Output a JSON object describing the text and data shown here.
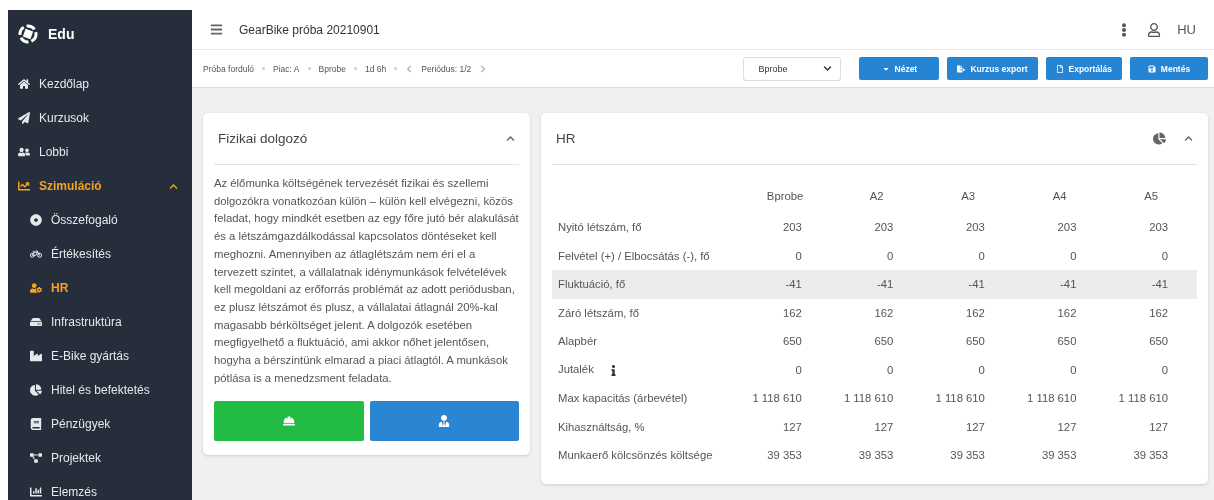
{
  "sidebar": {
    "brand": "Edu",
    "items": [
      {
        "label": "Kezdőlap",
        "selected": false
      },
      {
        "label": "Kurzusok",
        "selected": false
      },
      {
        "label": "Lobbi",
        "selected": false
      },
      {
        "label": "Szimuláció",
        "selected": true,
        "expanded": true,
        "children": [
          {
            "label": "Összefogaló",
            "selected": false
          },
          {
            "label": "Értékesítés",
            "selected": false
          },
          {
            "label": "HR",
            "selected": true
          },
          {
            "label": "Infrastruktúra",
            "selected": false
          },
          {
            "label": "E-Bike gyártás",
            "selected": false
          },
          {
            "label": "Hitel és befektetés",
            "selected": false
          },
          {
            "label": "Pénzügyek",
            "selected": false
          },
          {
            "label": "Projektek",
            "selected": false
          },
          {
            "label": "Elemzés",
            "selected": false
          }
        ]
      }
    ]
  },
  "header": {
    "title": "GearBike próba 20210901",
    "language": "HU"
  },
  "breadcrumb": {
    "items": [
      "Próba forduló",
      "Piac: A",
      "Bprobe",
      "1d 6h"
    ],
    "period": "Periódus: 1/2"
  },
  "toolbar": {
    "select": "Bprobe",
    "buttons": [
      "Nézet",
      "Kurzus export",
      "Exportálás",
      "Mentés"
    ]
  },
  "info_card": {
    "title": "Fizikai dolgozó",
    "text": "Az élőmunka költségének tervezését fizikai és szellemi dolgozókra vonatkozóan külön – külön kell elvégezni, közös feladat, hogy mindkét esetben az egy főre jutó bér alakulását és a létszámgazdálkodással kapcsolatos döntéseket kell meghozni. Amennyiben az átlaglétszám nem éri el a tervezett szintet, a vállalatnak idénymunkások felvételévek kell megoldani az erőforrás problémát az adott periódusban, ez plusz létszámot és plusz, a vállalatai átlagnál 20%-kal magasabb bérköltséget jelent. A dolgozók esetében megfigyelhető a fluktuáció, ami akkor nőhet jelentősen, hogyha a bérszintünk elmarad a piaci átlagtól. A munkások pótlása is a menedzsment feladata.",
    "worker_buttons": [
      {
        "color": "#22bb44"
      },
      {
        "color": "#2a86d2"
      }
    ]
  },
  "hr_card": {
    "title": "HR",
    "table": {
      "columns": [
        "Bprobe",
        "A2",
        "A3",
        "A4",
        "A5"
      ],
      "rows": [
        {
          "label": "Nyitó létszám, fő",
          "info": false,
          "highlighted": false,
          "values": [
            "203",
            "203",
            "203",
            "203",
            "203"
          ]
        },
        {
          "label": "Felvétel (+) / Elbocsátás (-), fő",
          "info": false,
          "highlighted": false,
          "values": [
            "0",
            "0",
            "0",
            "0",
            "0"
          ]
        },
        {
          "label": "Fluktuáció, fő",
          "info": false,
          "highlighted": true,
          "values": [
            "-41",
            "-41",
            "-41",
            "-41",
            "-41"
          ]
        },
        {
          "label": "Záró létszám, fő",
          "info": false,
          "highlighted": false,
          "values": [
            "162",
            "162",
            "162",
            "162",
            "162"
          ]
        },
        {
          "label": "Alapbér",
          "info": false,
          "highlighted": false,
          "values": [
            "650",
            "650",
            "650",
            "650",
            "650"
          ]
        },
        {
          "label": "Jutalék",
          "info": true,
          "highlighted": false,
          "values": [
            "0",
            "0",
            "0",
            "0",
            "0"
          ]
        },
        {
          "label": "Max kapacitás (árbevétel)",
          "info": false,
          "highlighted": false,
          "values": [
            "1 118 610",
            "1 118 610",
            "1 118 610",
            "1 118 610",
            "1 118 610"
          ]
        },
        {
          "label": "Kihasználtság, %",
          "info": false,
          "highlighted": false,
          "values": [
            "127",
            "127",
            "127",
            "127",
            "127"
          ]
        },
        {
          "label": "Munkaerő kölcsönzés költsége",
          "info": false,
          "highlighted": false,
          "values": [
            "39 353",
            "39 353",
            "39 353",
            "39 353",
            "39 353"
          ]
        }
      ]
    }
  }
}
